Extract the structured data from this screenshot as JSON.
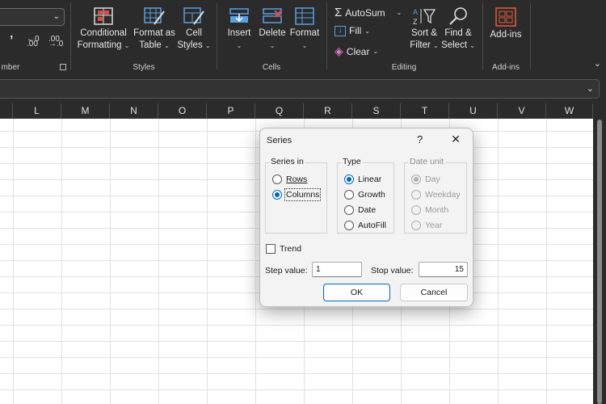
{
  "ribbon": {
    "number_group_label": "mber",
    "styles_group": {
      "label": "Styles",
      "conditional_formatting": [
        "Conditional",
        "Formatting"
      ],
      "format_as_table": [
        "Format as",
        "Table"
      ],
      "cell_styles": [
        "Cell",
        "Styles"
      ]
    },
    "cells_group": {
      "label": "Cells",
      "insert": "Insert",
      "delete": "Delete",
      "format": "Format"
    },
    "editing_group": {
      "label": "Editing",
      "autosum": "AutoSum",
      "fill": "Fill",
      "clear": "Clear",
      "sort_filter": [
        "Sort &",
        "Filter"
      ],
      "find_select": [
        "Find &",
        "Select"
      ]
    },
    "addins_group": {
      "label": "Add-ins",
      "addins": "Add-ins"
    }
  },
  "columns": [
    "L",
    "M",
    "N",
    "O",
    "P",
    "Q",
    "R",
    "S",
    "T",
    "U",
    "V",
    "W"
  ],
  "dialog": {
    "title": "Series",
    "help": "?",
    "close": "✕",
    "series_in": {
      "legend": "Series in",
      "options": [
        "Rows",
        "Columns"
      ],
      "selected": "Columns"
    },
    "type": {
      "legend": "Type",
      "options": [
        "Linear",
        "Growth",
        "Date",
        "AutoFill"
      ],
      "selected": "Linear"
    },
    "date_unit": {
      "legend": "Date unit",
      "options": [
        "Day",
        "Weekday",
        "Month",
        "Year"
      ],
      "selected": "Day",
      "disabled": true
    },
    "trend_label": "Trend",
    "trend_checked": false,
    "step_value_label": "Step value:",
    "step_value": "1",
    "stop_value_label": "Stop value:",
    "stop_value": "15",
    "ok_label": "OK",
    "cancel_label": "Cancel"
  },
  "colors": {
    "ribbon_bg": "#2b2b2b",
    "accent": "#0067c0"
  }
}
